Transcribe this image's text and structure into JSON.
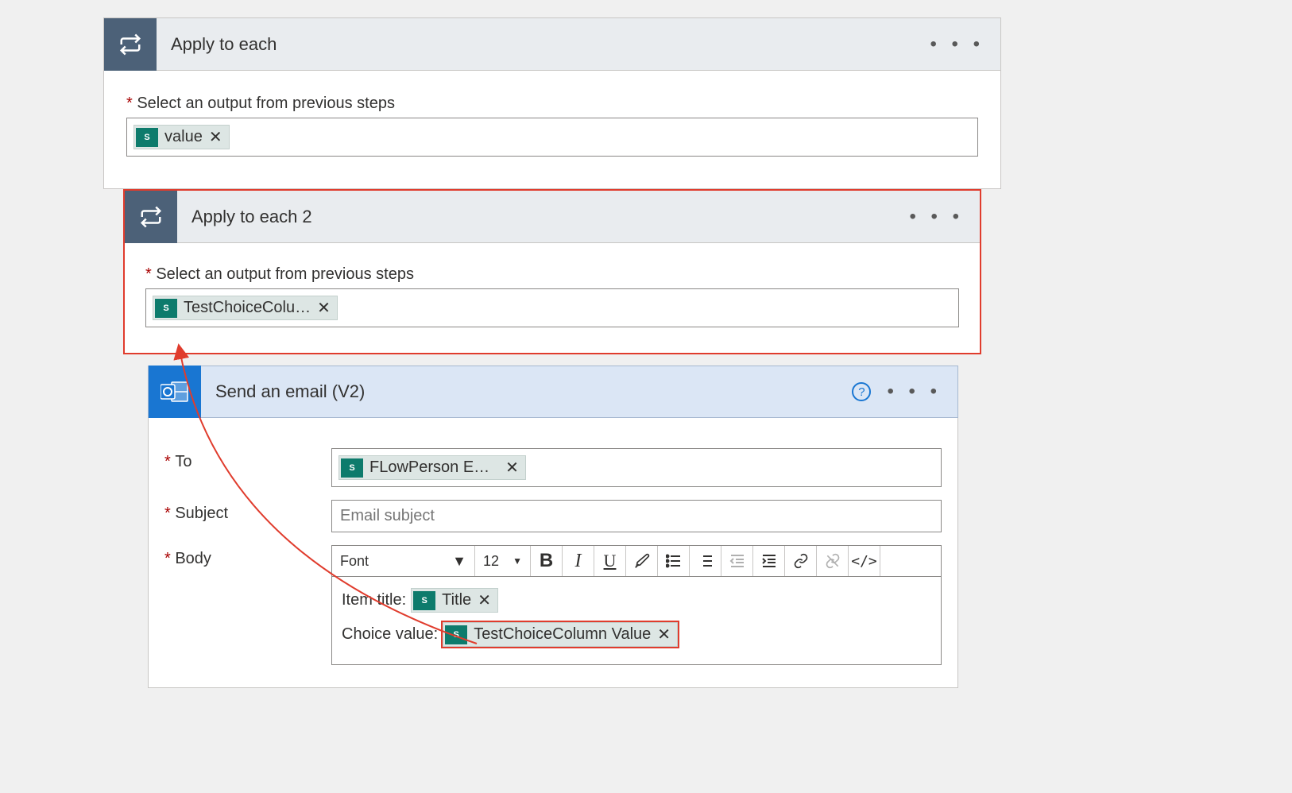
{
  "outer": {
    "title": "Apply to each",
    "menu": "• • •",
    "select_label": "Select an output from previous steps",
    "token_value": "value"
  },
  "inner": {
    "title": "Apply to each 2",
    "menu": "• • •",
    "select_label": "Select an output from previous steps",
    "token_value": "TestChoiceColu…"
  },
  "email": {
    "title": "Send an email (V2)",
    "menu": "• • •",
    "to_label": "To",
    "to_token": "FLowPerson E…",
    "subject_label": "Subject",
    "subject_placeholder": "Email subject",
    "body_label": "Body",
    "toolbar": {
      "font": "Font",
      "size": "12",
      "code": "</>"
    },
    "body_line1_label": "Item title:",
    "body_line1_token": "Title",
    "body_line2_label": "Choice value:",
    "body_line2_token": "TestChoiceColumn Value"
  }
}
